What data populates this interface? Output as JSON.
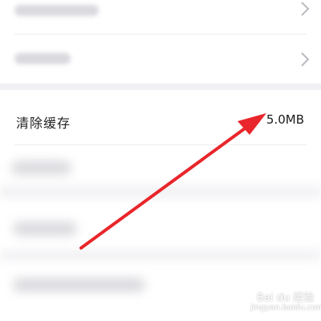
{
  "settings": {
    "clear_cache": {
      "label": "清除缓存",
      "value": "5.0MB"
    }
  },
  "colors": {
    "arrow": "#e8262b",
    "section_gap": "#f1f1f5",
    "chevron": "#b9b9c0"
  },
  "icons": [
    "chevron-right-icon",
    "arrow-annotation-icon"
  ],
  "watermark": {
    "brand": "Bai du 经验",
    "url": "jingyan.baidu.com"
  }
}
